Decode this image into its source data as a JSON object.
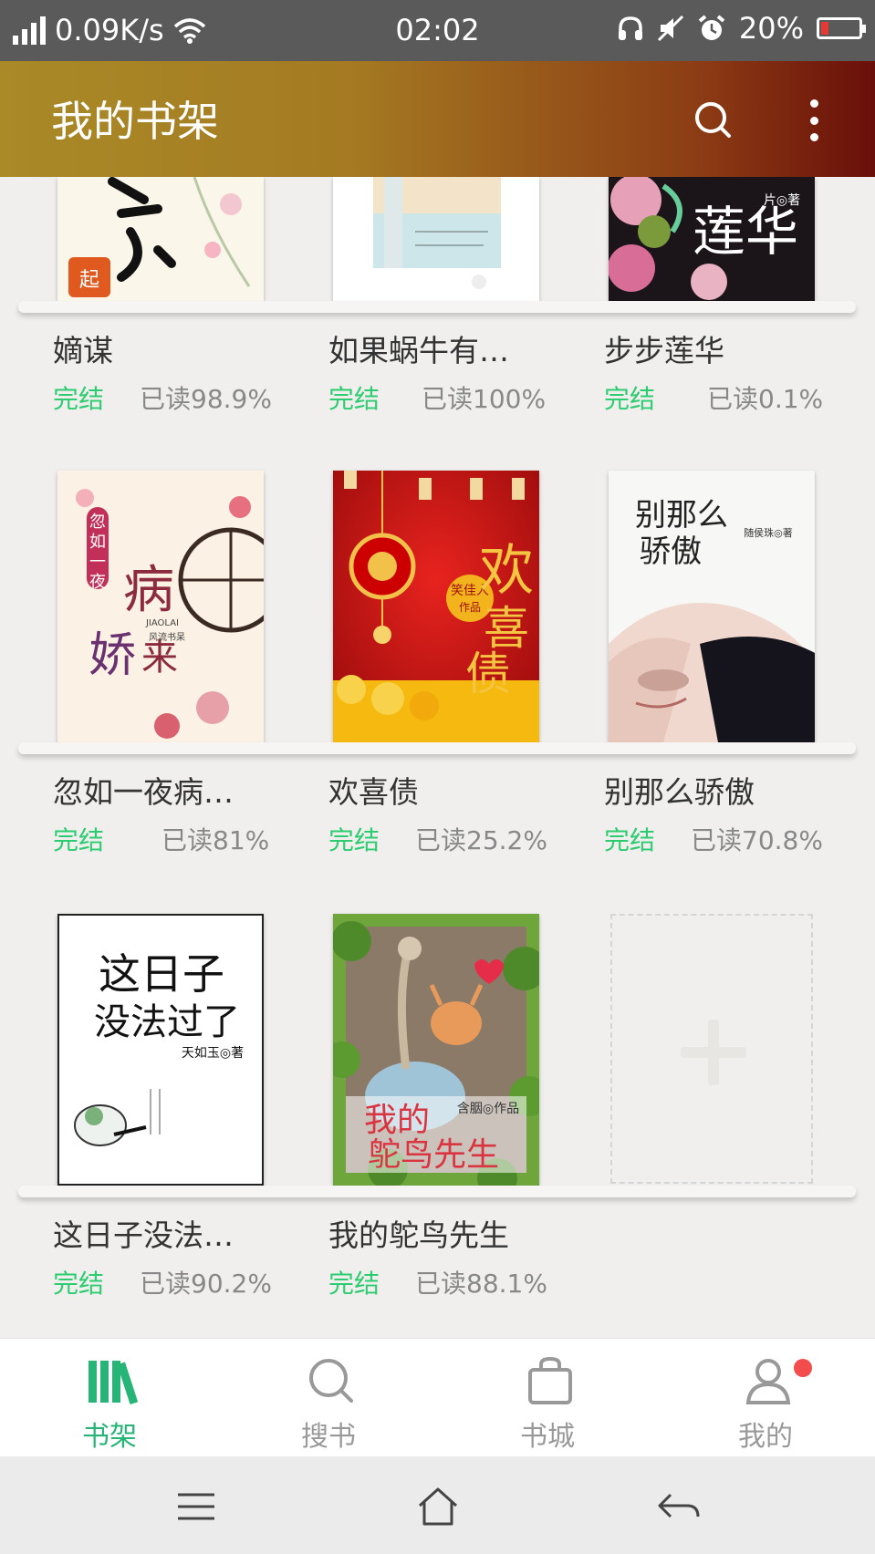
{
  "status_bar": {
    "speed": "0.09K/s",
    "time": "02:02",
    "battery": "20%",
    "icons": [
      "signal-icon",
      "wifi-icon",
      "headphones-icon",
      "mute-icon",
      "alarm-icon",
      "battery-icon"
    ]
  },
  "app_bar": {
    "title": "我的书架",
    "icons": [
      "search-icon",
      "more-icon"
    ],
    "color_start": "#a98a27",
    "color_end": "#6a0f0a"
  },
  "books": [
    {
      "name": "嫡谋",
      "status": "完结",
      "progress": "已读98.9%"
    },
    {
      "name": "如果蜗牛有…",
      "status": "完结",
      "progress": "已读100%"
    },
    {
      "name": "步步莲华",
      "status": "完结",
      "progress": "已读0.1%"
    },
    {
      "name": "忽如一夜病…",
      "status": "完结",
      "progress": "已读81%"
    },
    {
      "name": "欢喜债",
      "status": "完结",
      "progress": "已读25.2%"
    },
    {
      "name": "别那么骄傲",
      "status": "完结",
      "progress": "已读70.8%"
    },
    {
      "name": "这日子没法…",
      "status": "完结",
      "progress": "已读90.2%"
    },
    {
      "name": "我的鸵鸟先生",
      "status": "完结",
      "progress": "已读88.1%"
    }
  ],
  "covers": {
    "b3_author": "片◎著",
    "b3_title": "莲华",
    "b4_title": "忽如一夜病娇来",
    "b4_sub": "JIAOLAI",
    "b4_pub": "风流书呆",
    "b5_title": "欢喜债",
    "b5_author": "笑佳人作品",
    "b6_title_1": "别那么",
    "b6_title_2": "骄傲",
    "b6_author": "随侯珠◎著",
    "b7_title_1": "这日子",
    "b7_title_2": "没法过了",
    "b7_author": "天如玉◎著",
    "b8_title_1": "我的",
    "b8_title_2": "鸵鸟先生",
    "b8_author": "含胭◎作品"
  },
  "add_book": {
    "icon": "plus-icon"
  },
  "bottom_nav": [
    {
      "label": "书架",
      "icon": "bookshelf-icon",
      "active": true
    },
    {
      "label": "搜书",
      "icon": "search-icon",
      "active": false
    },
    {
      "label": "书城",
      "icon": "bag-icon",
      "active": false
    },
    {
      "label": "我的",
      "icon": "user-icon",
      "active": false,
      "badge": true
    }
  ],
  "system_nav": [
    "menu-icon",
    "home-icon",
    "back-icon"
  ],
  "colors": {
    "accent": "#27b577",
    "status": "#2ecc71",
    "badge": "#f24c4c"
  }
}
